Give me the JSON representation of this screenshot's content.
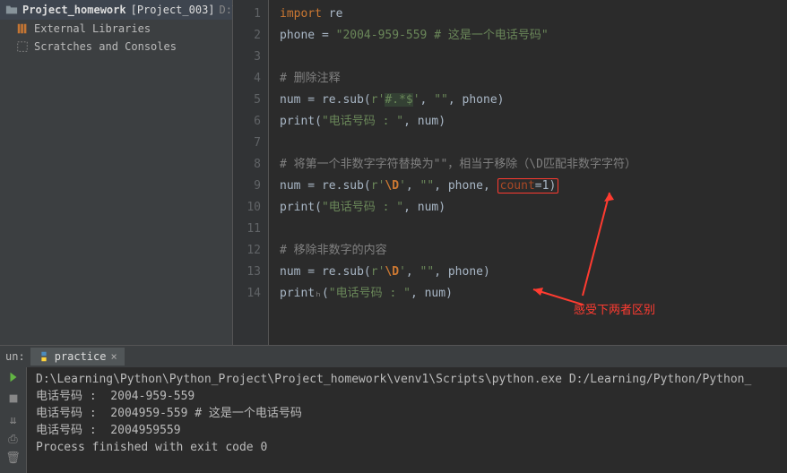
{
  "sidebar": {
    "project_name": "Project_homework",
    "project_bracket": "[Project_003]",
    "project_path": "D:\\Lear",
    "ext_lib": "External Libraries",
    "scratches": "Scratches and Consoles"
  },
  "gutter": {
    "l1": "1",
    "l2": "2",
    "l3": "3",
    "l4": "4",
    "l5": "5",
    "l6": "6",
    "l7": "7",
    "l8": "8",
    "l9": "9",
    "l10": "10",
    "l11": "11",
    "l12": "12",
    "l13": "13",
    "l14": "14"
  },
  "code": {
    "l1_kw": "import",
    "l1_rest": " re",
    "l2_a": "phone = ",
    "l2_str": "\"2004-959-559 # 这是一个电话号码\"",
    "l4_cmt": "# 删除注释",
    "l5_a": "num = re.sub(",
    "l5_r": "r'",
    "l5_pat": "#.*$",
    "l5_q": "'",
    "l5_c": ", ",
    "l5_empty": "\"\"",
    "l5_d": ",  phone)",
    "l6_a": "print(",
    "l6_str": "\"电话号码 : \"",
    "l6_b": ", num)",
    "l8_cmt": "# 将第一个非数字字符替换为\"\"，相当于移除（\\D匹配非数字字符）",
    "l9_a": "num = re.sub(",
    "l9_r": "r'",
    "l9_esc": "\\D",
    "l9_q": "'",
    "l9_c": ", ",
    "l9_empty": "\"\"",
    "l9_d": ", phone, ",
    "l9_param": "count",
    "l9_e": "=1)",
    "l10_a": "print(",
    "l10_str": "\"电话号码 : \"",
    "l10_b": ", num)",
    "l12_cmt": "# 移除非数字的内容",
    "l13_a": "num = re.sub(",
    "l13_r": "r'",
    "l13_esc": "\\D",
    "l13_q": "'",
    "l13_c": ", ",
    "l13_empty": "\"\"",
    "l13_d": ", phone)",
    "l14_a": "print",
    "l14_u": "ₕ",
    "l14_b": "(",
    "l14_str": "\"电话号码 : \"",
    "l14_c": ", num)"
  },
  "annotation": "感受下两者区别",
  "run": {
    "label": "un:",
    "tab": "practice",
    "out1": "D:\\Learning\\Python\\Python_Project\\Project_homework\\venv1\\Scripts\\python.exe D:/Learning/Python/Python_",
    "out2": "电话号码 :  2004-959-559 ",
    "out3": "电话号码 :  2004959-559 # 这是一个电话号码",
    "out4": "电话号码 :  2004959559",
    "out5": "",
    "out6": "Process finished with exit code 0"
  }
}
